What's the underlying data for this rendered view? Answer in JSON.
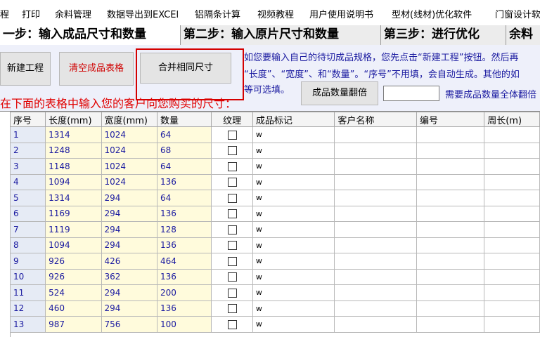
{
  "menu": [
    "程",
    "打印",
    "余料管理",
    "数据导出到EXCEl",
    "铝隔条计算",
    "视频教程",
    "用户使用说明书",
    "型材(线材)优化软件",
    "门窗设计软"
  ],
  "tabs": [
    "一步：输入成品尺寸和数量",
    "第二步：输入原片尺寸和数量",
    "第三步：进行优化",
    "余料"
  ],
  "buttons": {
    "new_project": "新建工程",
    "clear_table": "清空成品表格",
    "merge_same": "合并相同尺寸",
    "multiply_qty": "成品数量翻倍"
  },
  "info_lines": [
    "如您要输入自己的待切成品规格，您先点击“新建工程”按钮。然后再",
    "“长度”、“宽度”、和“数量”。“序号”不用填，会自动生成。其他的如",
    "等可选填。"
  ],
  "multiply_hint": "需要成品数量全体翻倍",
  "red_hint": "在下面的表格中输入您的客户向您购买的尺寸：",
  "table": {
    "headers": [
      "序号",
      "长度(mm)",
      "宽度(mm)",
      "数量",
      "纹理",
      "成品标记",
      "客户名称",
      "编号",
      "周长(m)"
    ],
    "rows": [
      [
        "1",
        "1314",
        "1024",
        "64",
        "w"
      ],
      [
        "2",
        "1248",
        "1024",
        "68",
        "w"
      ],
      [
        "3",
        "1148",
        "1024",
        "64",
        "w"
      ],
      [
        "4",
        "1094",
        "1024",
        "136",
        "w"
      ],
      [
        "5",
        "1314",
        "294",
        "64",
        "w"
      ],
      [
        "6",
        "1169",
        "294",
        "136",
        "w"
      ],
      [
        "7",
        "1119",
        "294",
        "128",
        "w"
      ],
      [
        "8",
        "1094",
        "294",
        "136",
        "w"
      ],
      [
        "9",
        "926",
        "426",
        "464",
        "w"
      ],
      [
        "10",
        "926",
        "362",
        "136",
        "w"
      ],
      [
        "11",
        "524",
        "294",
        "200",
        "w"
      ],
      [
        "12",
        "460",
        "294",
        "136",
        "w"
      ],
      [
        "13",
        "987",
        "756",
        "100",
        "w"
      ]
    ]
  }
}
